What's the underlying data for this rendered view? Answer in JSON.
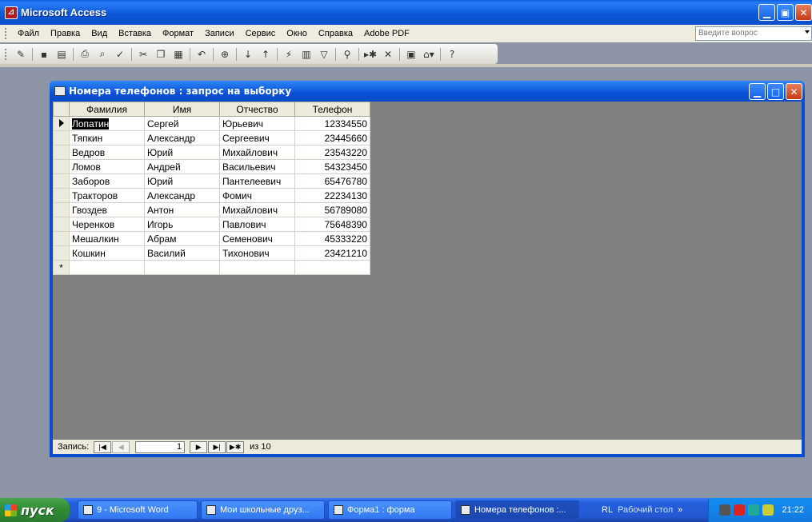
{
  "app": {
    "title": "Microsoft Access"
  },
  "menu": [
    "Файл",
    "Правка",
    "Вид",
    "Вставка",
    "Формат",
    "Записи",
    "Сервис",
    "Окно",
    "Справка",
    "Adobe PDF"
  ],
  "help_placeholder": "Введите вопрос",
  "toolbar_icons": [
    "design-view-icon",
    "save-icon",
    "search-file-icon",
    "print-icon",
    "print-preview-icon",
    "spelling-icon",
    "cut-icon",
    "copy-icon",
    "paste-icon",
    "undo-icon",
    "hyperlink-icon",
    "sort-ascending-icon",
    "sort-descending-icon",
    "filter-by-selection-icon",
    "filter-by-form-icon",
    "apply-filter-icon",
    "find-icon",
    "new-record-icon",
    "delete-record-icon",
    "database-window-icon",
    "new-object-icon",
    "help-icon"
  ],
  "child_window": {
    "title": "Номера телефонов : запрос на выборку"
  },
  "table": {
    "columns": [
      "Фамилия",
      "Имя",
      "Отчество",
      "Телефон"
    ],
    "rows": [
      [
        "Лопатин",
        "Сергей",
        "Юрьевич",
        "12334550"
      ],
      [
        "Тяпкин",
        "Александр",
        "Сергеевич",
        "23445660"
      ],
      [
        "Ведров",
        "Юрий",
        "Михайлович",
        "23543220"
      ],
      [
        "Ломов",
        "Андрей",
        "Васильевич",
        "54323450"
      ],
      [
        "Заборов",
        "Юрий",
        "Пантелеевич",
        "65476780"
      ],
      [
        "Тракторов",
        "Александр",
        "Фомич",
        "22234130"
      ],
      [
        "Гвоздев",
        "Антон",
        "Михайлович",
        "56789080"
      ],
      [
        "Черенков",
        "Игорь",
        "Павлович",
        "75648390"
      ],
      [
        "Мешалкин",
        "Абрам",
        "Семенович",
        "45333220"
      ],
      [
        "Кошкин",
        "Василий",
        "Тихонович",
        "23421210"
      ]
    ],
    "new_row_marker": "*"
  },
  "record_nav": {
    "label": "Запись:",
    "current": "1",
    "of_text": "из 10"
  },
  "taskbar": {
    "start_label": "пуск",
    "tasks": [
      "9 - Microsoft Word",
      "Мои школьные друз...",
      "Форма1 : форма",
      "Номера телефонов :..."
    ],
    "quick_label": "RL",
    "desktop_label": "Рабочий стол",
    "clock": "21:22"
  }
}
